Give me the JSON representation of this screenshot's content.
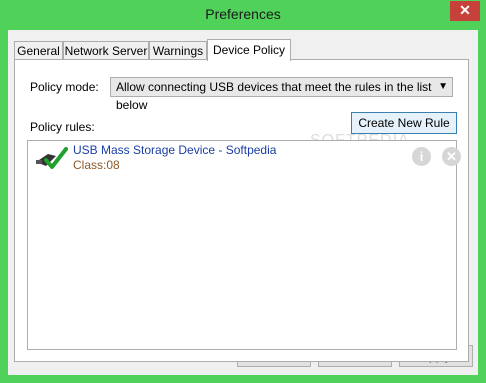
{
  "window": {
    "title": "Preferences",
    "close_glyph": "✕"
  },
  "tabs": [
    {
      "label": "General"
    },
    {
      "label": "Network Server"
    },
    {
      "label": "Warnings"
    },
    {
      "label": "Device Policy"
    }
  ],
  "policy": {
    "mode_label": "Policy mode:",
    "mode_value": "Allow connecting USB devices that meet the rules in the list below",
    "rules_label": "Policy rules:",
    "create_button": "Create New Rule"
  },
  "rules": [
    {
      "title": "USB Mass Storage Device - Softpedia",
      "subtitle": "Class:08",
      "icon": "usb-check-icon"
    }
  ],
  "watermark": "SOFTPEDIA",
  "footer": {
    "ok": "OK",
    "cancel": "Cancel",
    "apply": "Apply"
  },
  "colors": {
    "frame": "#50d25a",
    "close": "#c7413b",
    "rule_title": "#1a3ea6",
    "rule_subtitle": "#8b5a2b"
  }
}
